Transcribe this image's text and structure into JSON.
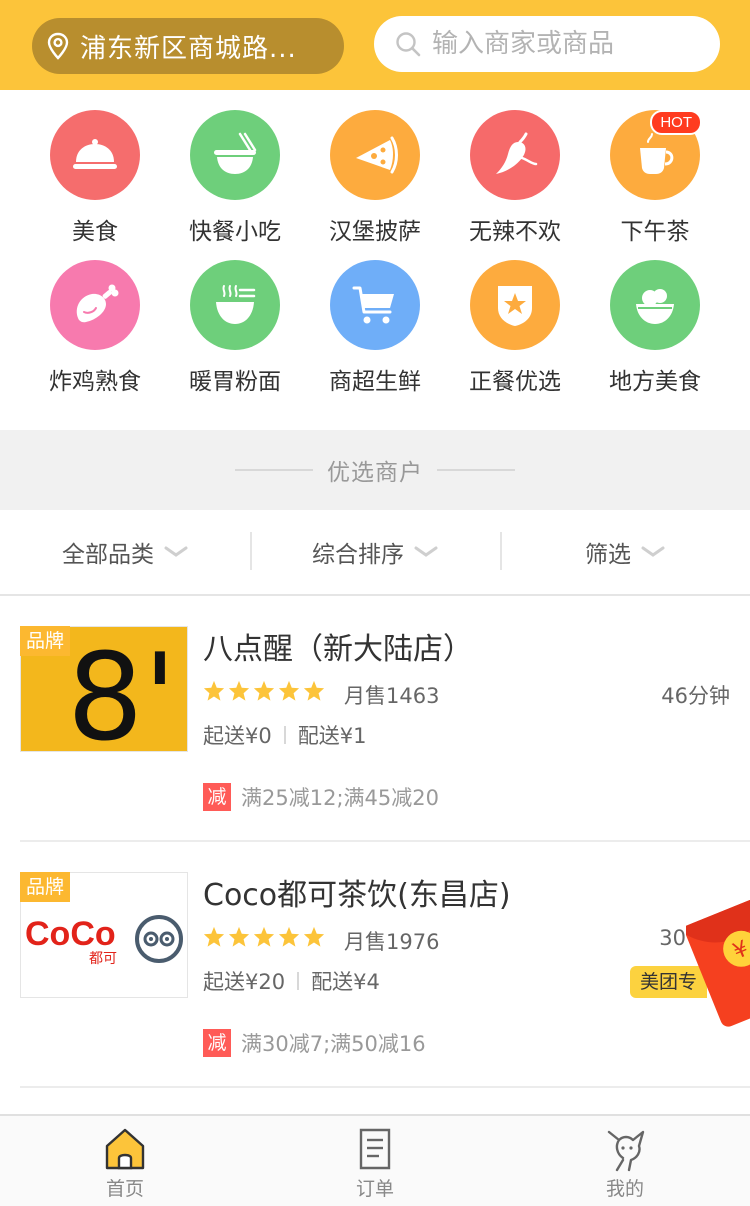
{
  "header": {
    "location": "浦东新区商城路...",
    "search_placeholder": "输入商家或商品"
  },
  "categories": [
    {
      "label": "美食",
      "icon": "dish-cover-icon",
      "color": "#f56d6d"
    },
    {
      "label": "快餐小吃",
      "icon": "noodle-bowl-icon",
      "color": "#6ecf7b"
    },
    {
      "label": "汉堡披萨",
      "icon": "pizza-slice-icon",
      "color": "#fdab3e"
    },
    {
      "label": "无辣不欢",
      "icon": "chili-pepper-icon",
      "color": "#f66a6a"
    },
    {
      "label": "下午茶",
      "icon": "tea-cup-icon",
      "color": "#fdab3e",
      "badge": "HOT"
    },
    {
      "label": "炸鸡熟食",
      "icon": "chicken-leg-icon",
      "color": "#f77aae"
    },
    {
      "label": "暖胃粉面",
      "icon": "hot-noodle-icon",
      "color": "#6ecf7b"
    },
    {
      "label": "商超生鲜",
      "icon": "shopping-cart-icon",
      "color": "#6faef8"
    },
    {
      "label": "正餐优选",
      "icon": "star-shield-icon",
      "color": "#fdab3e"
    },
    {
      "label": "地方美食",
      "icon": "rice-bowl-icon",
      "color": "#6ecf7b"
    }
  ],
  "section_title": "优选商户",
  "filters": [
    {
      "label": "全部品类"
    },
    {
      "label": "综合排序"
    },
    {
      "label": "筛选"
    }
  ],
  "shops": [
    {
      "brand_tag": "品牌",
      "logo_text": "8'",
      "name": "八点醒（新大陆店）",
      "rating_stars": 5,
      "monthly_sales": "月售1463",
      "eta": "46分钟",
      "min_order": "起送¥0",
      "delivery_fee": "配送¥1",
      "promo_badge": "减",
      "promo_text": "满25减12;满45减20"
    },
    {
      "brand_tag": "品牌",
      "logo_text": "CoCo",
      "logo_subtext": "都可",
      "name": "Coco都可茶饮(东昌店)",
      "rating_stars": 5,
      "monthly_sales": "月售1976",
      "eta": "30",
      "min_order": "起送¥20",
      "delivery_fee": "配送¥4",
      "delivery_tag": "美团专",
      "promo_badge": "减",
      "promo_text": "满30减7;满50减16"
    }
  ],
  "red_envelope_symbol": "¥",
  "tabs": [
    {
      "label": "首页",
      "icon": "home-icon",
      "active": true
    },
    {
      "label": "订单",
      "icon": "order-list-icon",
      "active": false
    },
    {
      "label": "我的",
      "icon": "kangaroo-profile-icon",
      "active": false
    }
  ],
  "colors": {
    "brand_yellow": "#fcc43a",
    "star": "#fcc43a",
    "promo_red": "#ff5b57"
  }
}
